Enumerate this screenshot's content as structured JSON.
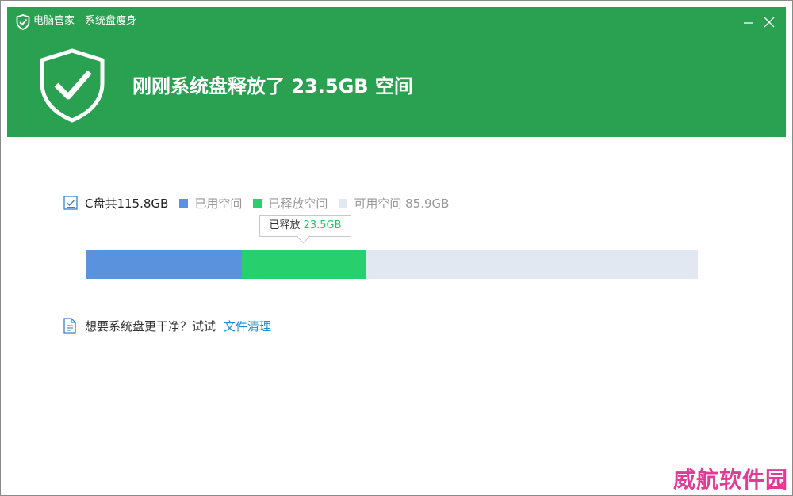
{
  "colors": {
    "brand_green": "#29a151",
    "used": "#5a92de",
    "freed": "#27d06c",
    "available": "#e2e8f1",
    "link": "#1e8fd6"
  },
  "titlebar": {
    "logo_icon": "shield-check-icon",
    "title": "电脑管家 - 系统盘瘦身",
    "minimize_icon": "minimize-icon",
    "close_icon": "close-icon"
  },
  "header": {
    "icon": "shield-check-icon",
    "headline": "刚刚系统盘释放了 23.5GB 空间"
  },
  "disk": {
    "icon": "checkbox-checked-icon",
    "total_label": "C盘共115.8GB",
    "total_gb": 115.8,
    "legend": [
      {
        "key": "used",
        "label": "已用空间",
        "color": "#5a92de"
      },
      {
        "key": "freed",
        "label": "已释放空间",
        "color": "#27d06c"
      },
      {
        "key": "available",
        "label": "可用空间 85.9GB",
        "color": "#e2e8f1"
      }
    ],
    "usage_gb": {
      "used": 29.6,
      "freed": 23.5,
      "available": 62.7
    },
    "tooltip": {
      "prefix": "已释放 ",
      "value": "23.5GB"
    }
  },
  "hint": {
    "icon": "document-icon",
    "text": "想要系统盘更干净？试试",
    "link": "文件清理"
  },
  "watermark": "威航软件园"
}
